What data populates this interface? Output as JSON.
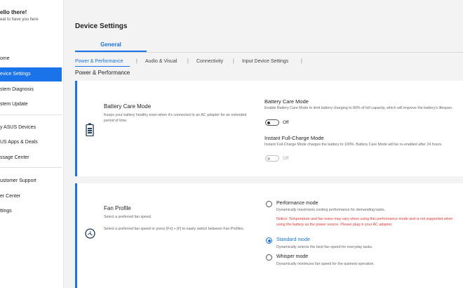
{
  "sidebar": {
    "greeting": "ello there!",
    "greeting_sub": "eat to have you here",
    "items": [
      {
        "label": "ome"
      },
      {
        "label": "evice Settings"
      },
      {
        "label": "stem Diagnosis"
      },
      {
        "label": "stem Update"
      },
      {
        "label": "y ASUS Devices"
      },
      {
        "label": "US Apps & Deals"
      },
      {
        "label": "ssage Center"
      },
      {
        "label": "ustomer Support"
      },
      {
        "label": "er Center"
      },
      {
        "label": "ttings"
      }
    ]
  },
  "main": {
    "title": "Device Settings",
    "top_tab": "General",
    "subtabs": [
      "Power & Performance",
      "Audio & Visual",
      "Connectivity",
      "Input Device Settings"
    ],
    "tab_separator": "|",
    "section_title": "Power & Performance"
  },
  "battery_card": {
    "icon": "battery-icon",
    "title": "Battery Care Mode",
    "description": "Keeps your battery healthy even when it's connected to an AC adapter for an extended period of time.",
    "option1": {
      "title": "Battery Care Mode",
      "description": "Enable Battery Care Mode to limit battery charging to 80% of full capacity, which will improve the battery's lifespan.",
      "toggle_label": "Off"
    },
    "option2": {
      "title": "Instant Full-Charge Mode",
      "description": "Instant Full-Charge Mode charges the battery to 100%. Battery Care Mode will be re-enabled after 24 hours.",
      "toggle_label": "Off"
    }
  },
  "fan_card": {
    "icon": "fan-icon",
    "title": "Fan Profile",
    "subtitle": "Select a preferred fan speed.",
    "description": "Select a preferred fan speed or press [Fn] + [F] to easily switch between Fan Profiles.",
    "modes": [
      {
        "label": "Performance mode",
        "description": "Dynamically maximizes cooling performance for demanding tasks.",
        "notice": "Notice: Temperature and fan noise may vary when using this performance mode and is not supported when using the battery as the power source. Please plug in your AC adapter."
      },
      {
        "label": "Standard mode",
        "description": "Dynamically selects the best fan speed for everyday tasks."
      },
      {
        "label": "Whisper mode",
        "description": "Dynamically minimizes fan speed for the quietest operation."
      }
    ],
    "selected_mode": "Standard mode"
  },
  "colors": {
    "accent": "#1a73e8",
    "notice": "#e53935"
  }
}
